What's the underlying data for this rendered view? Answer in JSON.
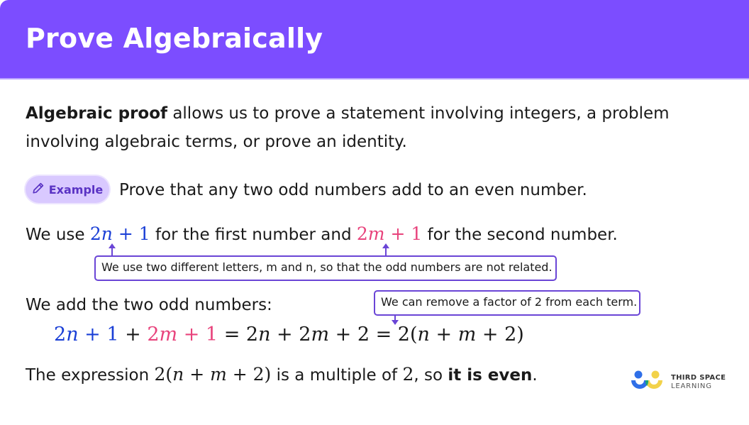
{
  "header": {
    "title": "Prove Algebraically",
    "background_color": "#7c4dff"
  },
  "intro": {
    "bold_term": "Algebraic proof",
    "line1_rest": " allows us to prove a statement involving integers, a problem",
    "line2": "involving algebraic terms, or prove an identity."
  },
  "example": {
    "badge_icon": "pencil-icon",
    "badge_label": "Example",
    "statement": "Prove that any two odd numbers add to an even number."
  },
  "step1": {
    "prefix": "We use ",
    "expr_n": {
      "coef": "2",
      "var": "n",
      "rest": " + 1"
    },
    "middle": " for the first number and ",
    "expr_m": {
      "coef": "2",
      "var": "m",
      "rest": " + 1"
    },
    "suffix": " for the second number.",
    "callout": "We use two different letters, m and n, so that the odd numbers are not related."
  },
  "step2": {
    "intro": "We add the two odd numbers:",
    "callout": "We can remove a factor of 2 from each term.",
    "equation": {
      "t1_coef": "2",
      "t1_var": "n",
      "t1_rest": " + 1",
      "plus": " + ",
      "t2_coef": "2",
      "t2_var": "m",
      "t2_rest": " + 1",
      "eq1": " = 2",
      "mid_n": "n",
      "mid_plus": " + 2",
      "mid_m": "m",
      "mid_rest": " + 2 = 2(",
      "f_n": "n",
      "f_plus": " + ",
      "f_m": "m",
      "f_rest": " + 2)"
    }
  },
  "conclusion": {
    "prefix": "The expression ",
    "expr_a": "2(",
    "expr_n": "n",
    "expr_plus": " + ",
    "expr_m": "m",
    "expr_b": " + 2)",
    "middle": " is a multiple of ",
    "two": "2",
    "comma": ", so ",
    "bold": "it is even",
    "end": "."
  },
  "logo": {
    "line1": "THIRD SPACE",
    "line2": "LEARNING",
    "colors": {
      "blue": "#2f6fe8",
      "yellow": "#f2d24a",
      "green": "#1aa37a"
    }
  },
  "colors": {
    "n_expr": "#1a3fd6",
    "m_expr": "#e8437c",
    "callout_border": "#6a45d6"
  }
}
